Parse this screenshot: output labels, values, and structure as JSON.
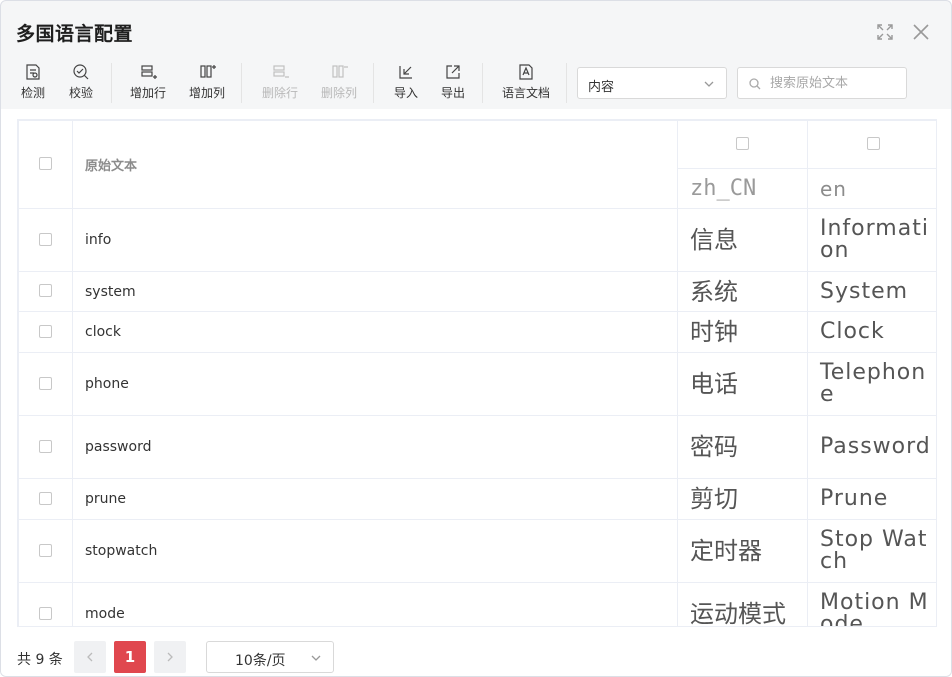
{
  "dialog": {
    "title": "多国语言配置"
  },
  "toolbar": {
    "detect_label": "检测",
    "verify_label": "校验",
    "add_row_label": "增加行",
    "add_col_label": "增加列",
    "delete_row_label": "删除行",
    "delete_col_label": "删除列",
    "import_label": "导入",
    "export_label": "导出",
    "lang_doc_label": "语言文档",
    "filter_select_value": "内容",
    "search_placeholder": "搜索原始文本"
  },
  "table": {
    "source_header": "原始文本",
    "languages": [
      "zh_CN",
      "en"
    ],
    "rows": [
      {
        "source": "info",
        "zh": "信息",
        "en": "Information"
      },
      {
        "source": "system",
        "zh": "系统",
        "en": "System"
      },
      {
        "source": "clock",
        "zh": "时钟",
        "en": "Clock"
      },
      {
        "source": "phone",
        "zh": "电话",
        "en": "Telephone"
      },
      {
        "source": "password",
        "zh": "密码",
        "en": "Password"
      },
      {
        "source": "prune",
        "zh": "剪切",
        "en": "Prune"
      },
      {
        "source": "stopwatch",
        "zh": "定时器",
        "en": "Stop Watch"
      },
      {
        "source": "mode",
        "zh": "运动模式",
        "en": "Motion Mode"
      }
    ]
  },
  "pagination": {
    "total_text": "共 9 条",
    "current_page": "1",
    "page_size": "10条/页"
  },
  "colors": {
    "accent": "#e0474e",
    "border": "#ebeef5",
    "toolbar_bg": "#f5f6f7"
  }
}
